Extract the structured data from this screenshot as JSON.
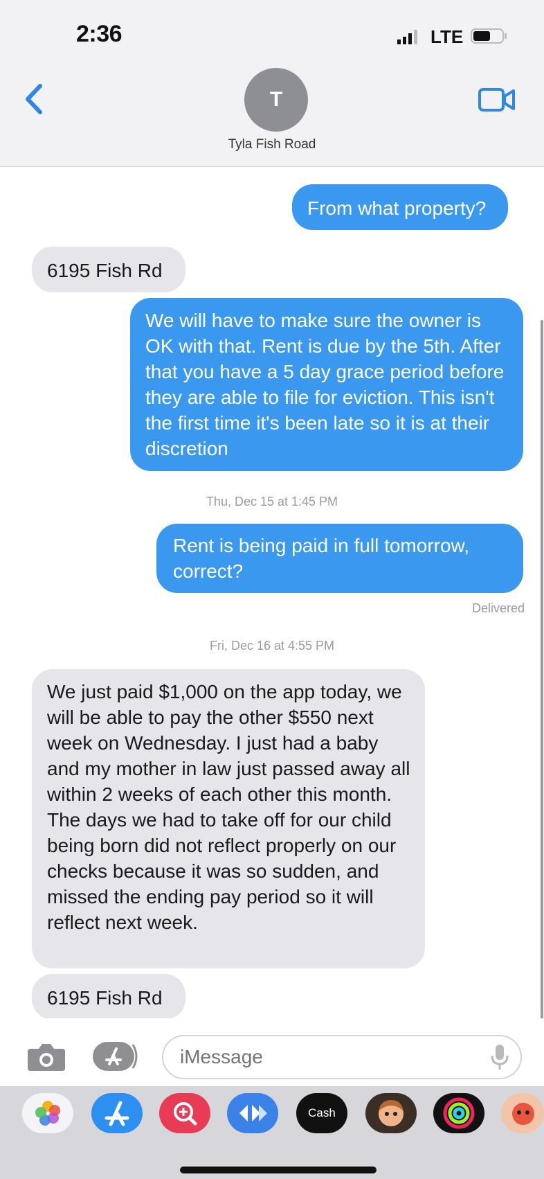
{
  "status_bar": {
    "time": "2:36",
    "carrier": "LTE"
  },
  "header": {
    "avatar_initial": "T",
    "contact_name": "Tyla Fish Road"
  },
  "messages": {
    "m1": "From what property?",
    "m2": "6195 Fish Rd",
    "m3": "We will have to make sure the owner is OK with that. Rent is due by the 5th. After that you have a 5 day grace period before they are able to file for eviction. This isn't the first time it's been late so it is at their discretion",
    "stamp1": "Thu, Dec 15 at 1:45 PM",
    "m4": "Rent is being paid in full tomorrow, correct?",
    "delivered": "Delivered",
    "stamp2": "Fri, Dec 16 at 4:55 PM",
    "m5": "We just paid $1,000 on the app today, we will be able to pay the other $550 next week on Wednesday. I just had a baby and my mother in law just passed away all within 2 weeks of each other this month. The days we had to take off for our child being born did not reflect properly on our checks because it was so sudden, and missed the ending pay period so it will reflect next week.",
    "m6": "6195 Fish Rd"
  },
  "input": {
    "placeholder": "iMessage"
  },
  "app_drawer": {
    "cash_label": "Cash",
    "apps": [
      "photos-app",
      "app-store-app",
      "image-search-app",
      "audio-message-app",
      "apple-cash-app",
      "memoji-app",
      "activity-app",
      "animoji-app"
    ]
  },
  "colors": {
    "sent_bubble": "#3a99ee",
    "received_bubble": "#e5e5ea",
    "accent": "#2f86e6"
  }
}
